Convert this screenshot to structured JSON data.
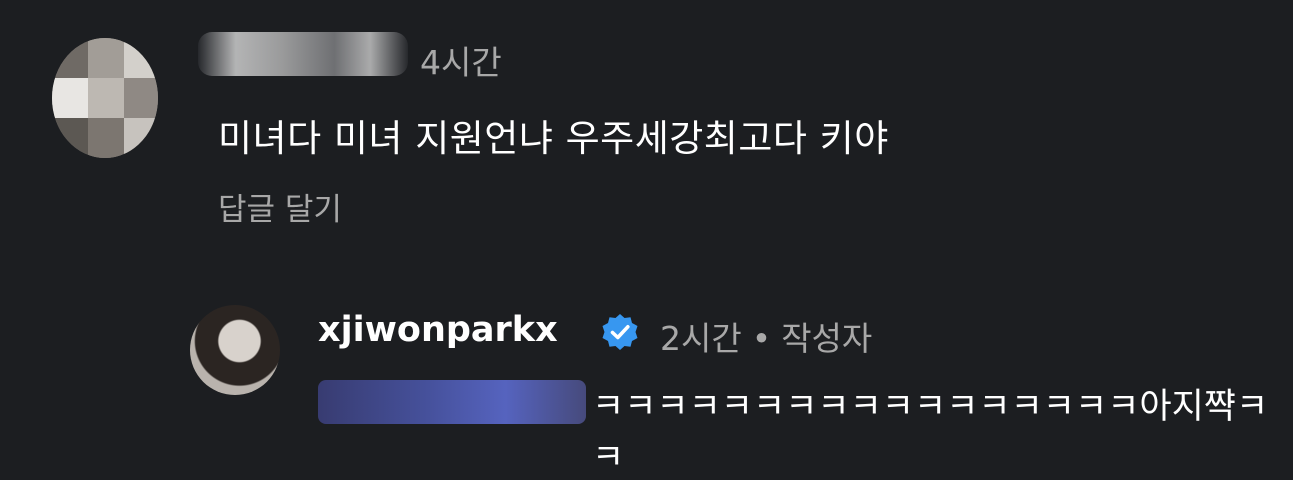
{
  "comments": [
    {
      "author": "",
      "time": "4시간",
      "text": "미녀다 미녀 지원언냐 우주세강최고다 키야",
      "reply_label": "답글 달기"
    },
    {
      "author": "xjiwonparkx",
      "time": "2시간",
      "separator": "•",
      "role_badge": "작성자",
      "text": "ㅋㅋㅋㅋㅋㅋㅋㅋㅋㅋㅋㅋㅋㅋㅋㅋㅋ아지쨕ㅋㅋ"
    }
  ],
  "icons": {
    "verified": "verified-badge-icon"
  },
  "colors": {
    "background": "#1c1e21",
    "text_primary": "#ffffff",
    "text_secondary": "#a8a8a8",
    "verified_blue": "#3797f0"
  }
}
